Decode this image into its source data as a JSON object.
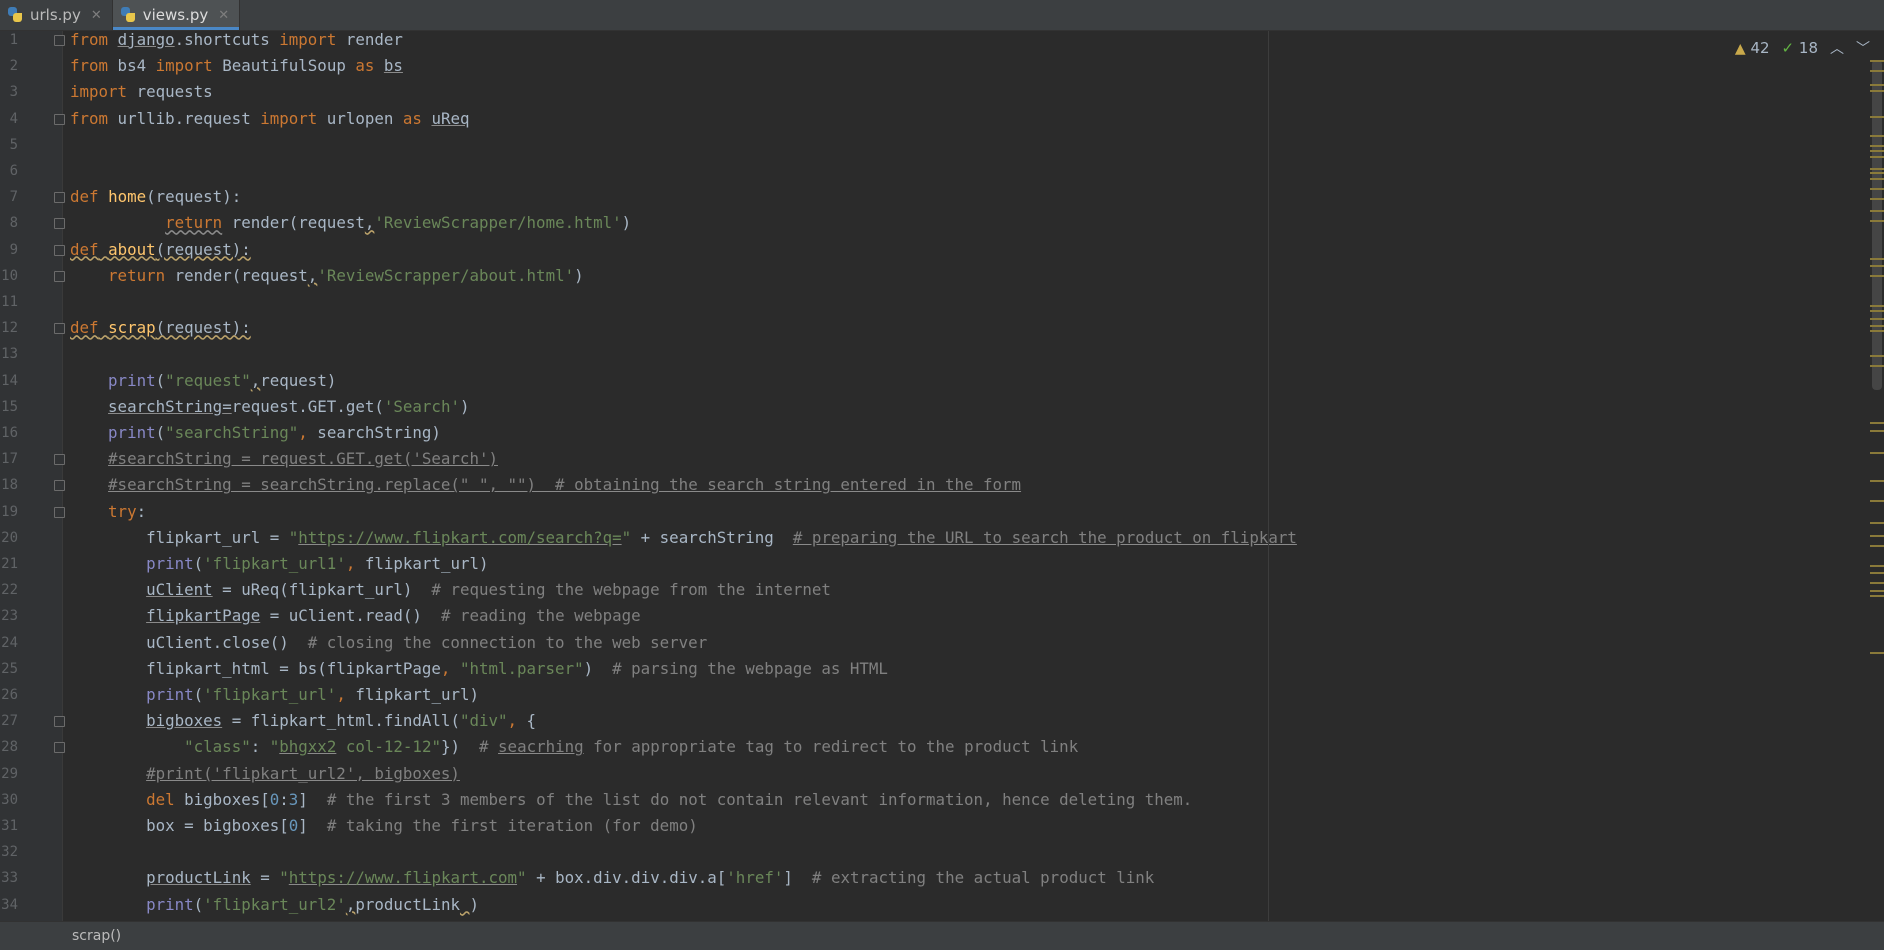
{
  "tabs": [
    {
      "label": "urls.py",
      "active": false
    },
    {
      "label": "views.py",
      "active": true
    }
  ],
  "inspection": {
    "warnings": "42",
    "ok": "18"
  },
  "breadcrumb": "scrap()",
  "lines": [
    {
      "n": "1",
      "html": "<span class='kw'>from</span> <span class='ul'>django</span>.shortcuts <span class='kw'>import</span> render"
    },
    {
      "n": "2",
      "html": "<span class='kw'>from</span> bs4 <span class='kw'>import</span> BeautifulSoup <span class='kw'>as</span> <span class='ul'>bs</span>"
    },
    {
      "n": "3",
      "html": "<span class='kw'>import</span> requests"
    },
    {
      "n": "4",
      "html": "<span class='kw'>from</span> urllib.request <span class='kw'>import</span> urlopen <span class='kw'>as</span> <span class='ul'>uReq</span>"
    },
    {
      "n": "5",
      "html": ""
    },
    {
      "n": "6",
      "html": ""
    },
    {
      "n": "7",
      "html": "<span class='kw'>def</span> <span class='fn'>home</span>(request):"
    },
    {
      "n": "8",
      "html": "          <span class='kw wavy'>return</span> render(request<span class='weak'>,</span><span class='str'>'ReviewScrapper/home.html'</span>)"
    },
    {
      "n": "9",
      "html": "<span class='weak'><span class='kw'>def</span> <span class='fn'>about</span>(request):</span>"
    },
    {
      "n": "10",
      "html": "    <span class='kw'>return</span> render(request<span class='weak'>,</span><span class='str'>'ReviewScrapper/about.html'</span>)"
    },
    {
      "n": "11",
      "html": ""
    },
    {
      "n": "12",
      "html": "<span class='weak'><span class='kw'>def</span> <span class='fn'>scrap</span>(request):</span>"
    },
    {
      "n": "13",
      "html": ""
    },
    {
      "n": "14",
      "html": "    <span class='builtin'>print</span>(<span class='str'>\"request\"</span><span class='weak'>,</span>request)"
    },
    {
      "n": "15",
      "html": "    <span class='ul'>searchString</span><span class='ul'>=</span>request.GET.get(<span class='str'>'Search'</span>)"
    },
    {
      "n": "16",
      "html": "    <span class='builtin'>print</span>(<span class='str'>\"searchString\"</span><span class='kw'>,</span> searchString)"
    },
    {
      "n": "17",
      "html": "    <span class='cm ul'>#searchString = request.GET.get('Search')</span>"
    },
    {
      "n": "18",
      "html": "    <span class='cm ul'>#searchString = searchString.replace(\" \", \"\")  # obtaining the search string entered in the form</span>"
    },
    {
      "n": "19",
      "html": "    <span class='kw'>try</span>:"
    },
    {
      "n": "20",
      "html": "        flipkart_url = <span class='str'>\"<span class='ul'>https://www.flipkart.com/search?q=</span>\"</span> + searchString  <span class='cm ul'># preparing the URL to search the product on flipkart</span>"
    },
    {
      "n": "21",
      "html": "        <span class='builtin'>print</span>(<span class='str'>'flipkart_url1'</span><span class='kw'>,</span> flipkart_url)"
    },
    {
      "n": "22",
      "html": "        <span class='ul'>uClient</span> = uReq(flipkart_url)  <span class='cm'># requesting the webpage from the internet</span>"
    },
    {
      "n": "23",
      "html": "        <span class='ul'>flipkartPage</span> = uClient.read()  <span class='cm'># reading the webpage</span>"
    },
    {
      "n": "24",
      "html": "        uClient.close()  <span class='cm'># closing the connection to the web server</span>"
    },
    {
      "n": "25",
      "html": "        flipkart_html = bs(flipkartPage<span class='kw'>,</span> <span class='str'>\"html.parser\"</span>)  <span class='cm'># parsing the webpage as HTML</span>"
    },
    {
      "n": "26",
      "html": "        <span class='builtin'>print</span>(<span class='str'>'flipkart_url'</span><span class='kw'>,</span> flipkart_url)"
    },
    {
      "n": "27",
      "html": "        <span class='ul'>bigboxes</span> = flipkart_html.findAll(<span class='str'>\"div\"</span><span class='kw'>,</span> {"
    },
    {
      "n": "28",
      "html": "            <span class='str'>\"class\"</span>: <span class='str'>\"<span class='ul'>bhgxx2</span> col-12-12\"</span>})  <span class='cm'># <span class='ul'>seacrhing</span> for appropriate tag to redirect to the product link</span>"
    },
    {
      "n": "29",
      "html": "        <span class='cm ul'>#print('flipkart_url2', bigboxes)</span>"
    },
    {
      "n": "30",
      "html": "        <span class='kw'>del</span> bigboxes[<span class='num'>0</span>:<span class='num'>3</span>]  <span class='cm'># the first 3 members of the list do not contain relevant information, hence deleting them.</span>"
    },
    {
      "n": "31",
      "html": "        box = bigboxes[<span class='num'>0</span>]  <span class='cm'># taking the first iteration (for demo)</span>"
    },
    {
      "n": "32",
      "html": ""
    },
    {
      "n": "33",
      "html": "        <span class='ul'>productLink</span> = <span class='str'>\"<span class='ul'>https://www.flipkart.com</span>\"</span> + box.div.div.div.a[<span class='str'>'href'</span>]  <span class='cm'># extracting the actual product link</span>"
    },
    {
      "n": "34",
      "html": "        <span class='builtin'>print</span>(<span class='str'>'flipkart_url2'</span><span class='weak'>,</span>productLink<span class='weak'> </span>)"
    }
  ]
}
